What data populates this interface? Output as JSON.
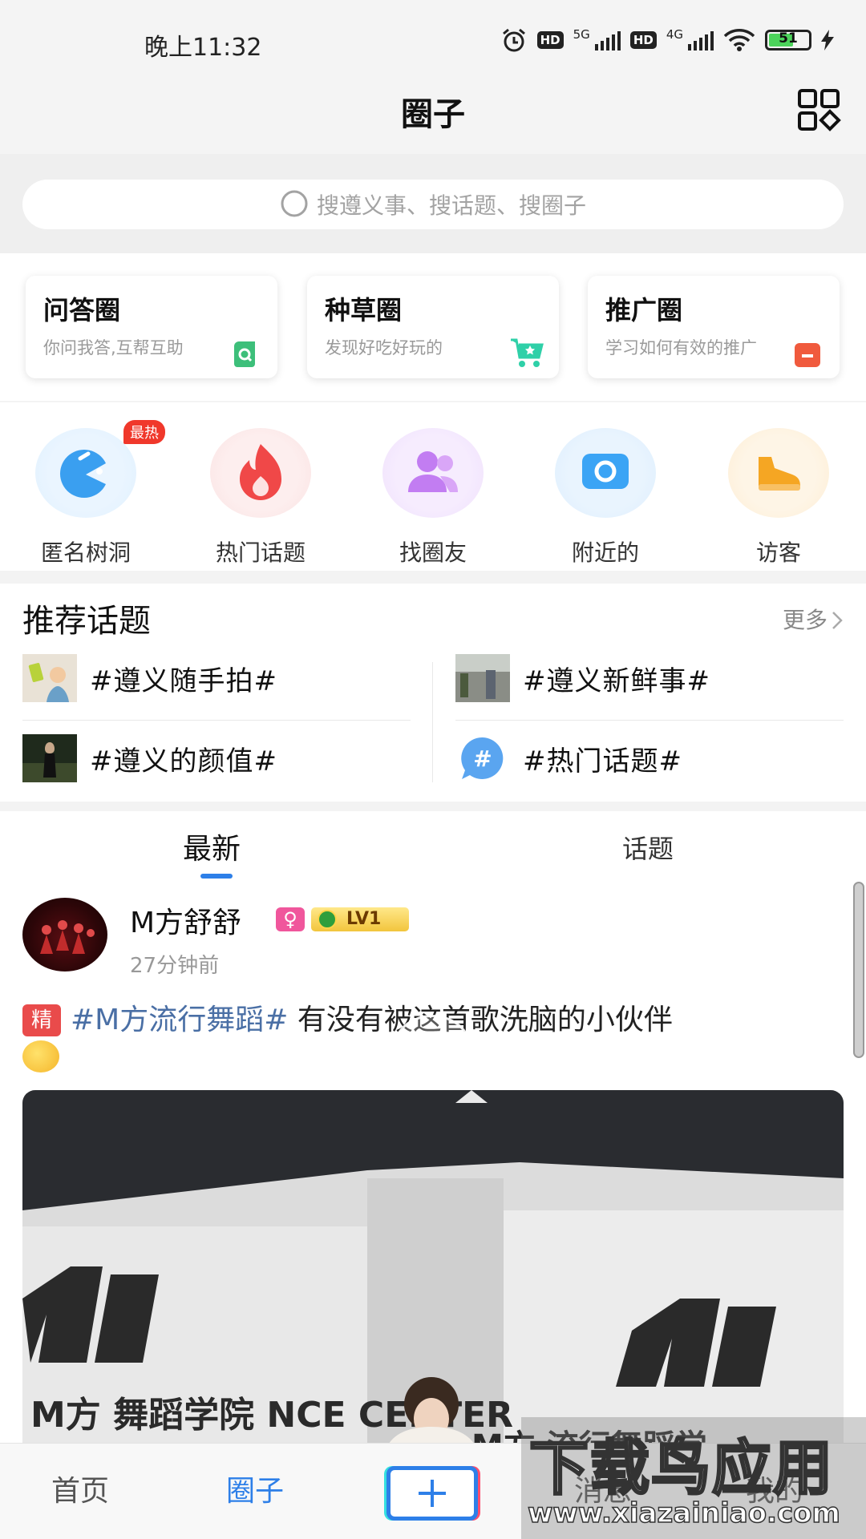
{
  "status_bar": {
    "time": "晚上11:32",
    "hd1": "HD",
    "net1": "5G",
    "hd2": "HD",
    "net2": "4G",
    "battery": "51"
  },
  "header": {
    "title": "圈子"
  },
  "search": {
    "placeholder": "搜遵义事、搜话题、搜圈子"
  },
  "circles": [
    {
      "title": "问答圈",
      "subtitle": "你问我答,互帮互助",
      "icon": "qa-icon",
      "color": "#3dbf7a"
    },
    {
      "title": "种草圈",
      "subtitle": "发现好吃好玩的",
      "icon": "cart-icon",
      "color": "#2fd0a8"
    },
    {
      "title": "推广圈",
      "subtitle": "学习如何有效的推广",
      "icon": "promo-icon",
      "color": "#f05a3d"
    }
  ],
  "features": [
    {
      "label": "匿名树洞",
      "badge": "最热",
      "icon": "pacman-icon",
      "color": "#3a9ff0"
    },
    {
      "label": "热门话题",
      "icon": "fire-icon",
      "color": "#f04848"
    },
    {
      "label": "找圈友",
      "icon": "friends-icon",
      "color": "#c27df2"
    },
    {
      "label": "附近的",
      "icon": "camera-icon",
      "color": "#3ba4f5"
    },
    {
      "label": "访客",
      "icon": "shoe-icon",
      "color": "#f5a623"
    }
  ],
  "topics": {
    "header": "推荐话题",
    "more": "更多",
    "items": [
      {
        "label": "#遵义随手拍#"
      },
      {
        "label": "#遵义新鲜事#"
      },
      {
        "label": "#遵义的颜值#"
      },
      {
        "label": "#热门话题#"
      }
    ]
  },
  "tabs": [
    {
      "label": "最新",
      "active": true
    },
    {
      "label": "话题",
      "active": false
    }
  ],
  "post": {
    "username": "M方舒舒",
    "gender": "♀",
    "level": "LV1",
    "time": "27分钟前",
    "badge": "精",
    "tag": "#M方流行舞蹈#",
    "text": " 有没有被这首歌洗脑的小伙伴",
    "video_banner_left": "M方 舞蹈学院 NCE CENTER",
    "video_banner_right": "M方 流行舞蹈学"
  },
  "bottom_nav": [
    {
      "label": "首页",
      "active": false
    },
    {
      "label": "圈子",
      "active": true
    },
    {
      "label": "消息",
      "active": false
    },
    {
      "label": "我的",
      "active": false
    }
  ],
  "watermark": {
    "line1": "下载鸟应用",
    "line2": "www.xiazainiao.com"
  },
  "colors": {
    "accent": "#2d7fe8",
    "topic_tag": "#4a6fa5",
    "hot_badge": "#f0382b"
  }
}
